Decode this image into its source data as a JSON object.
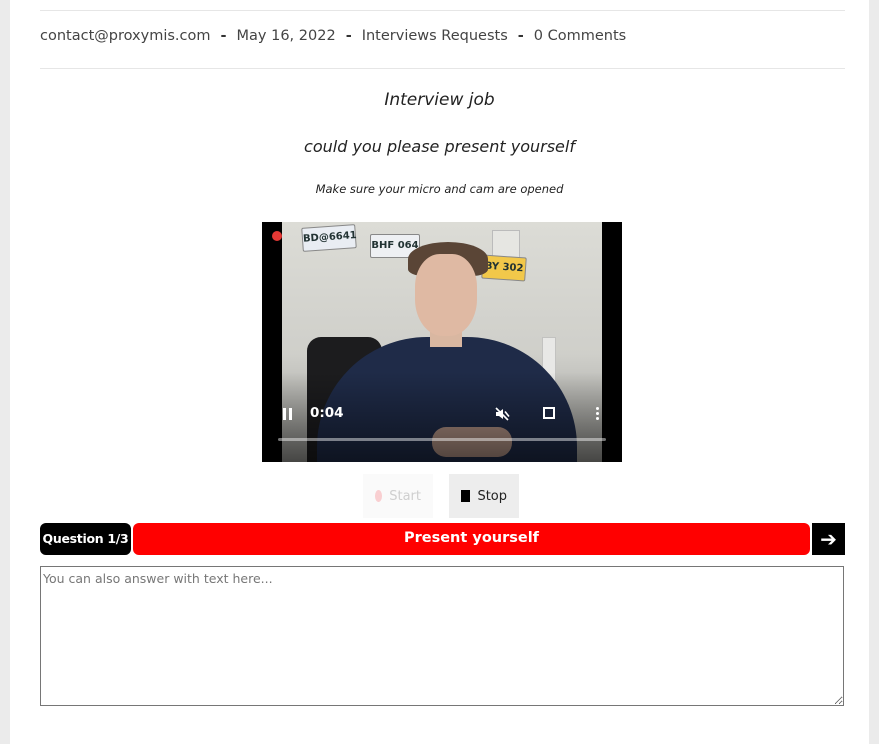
{
  "meta": {
    "author": "contact@proxymis.com",
    "date": "May 16, 2022",
    "category": "Interviews Requests",
    "comments": "0 Comments",
    "separator": "-"
  },
  "content": {
    "title": "Interview job",
    "question_text": "could you please present yourself",
    "instruction": "Make sure your micro and cam are opened"
  },
  "video": {
    "time": "0:04",
    "progress": 0.0,
    "recording_indicator_color": "#e53935",
    "plates": [
      "BD@6641",
      "BHF 064",
      "BY 302"
    ]
  },
  "recorder": {
    "start_label": "Start",
    "stop_label": "Stop"
  },
  "question_bar": {
    "counter": "Question 1/3",
    "title": "Present yourself",
    "next_icon": "arrow-right-icon",
    "accent": "#ff0000"
  },
  "answer": {
    "placeholder": "You can also answer with text here..."
  }
}
